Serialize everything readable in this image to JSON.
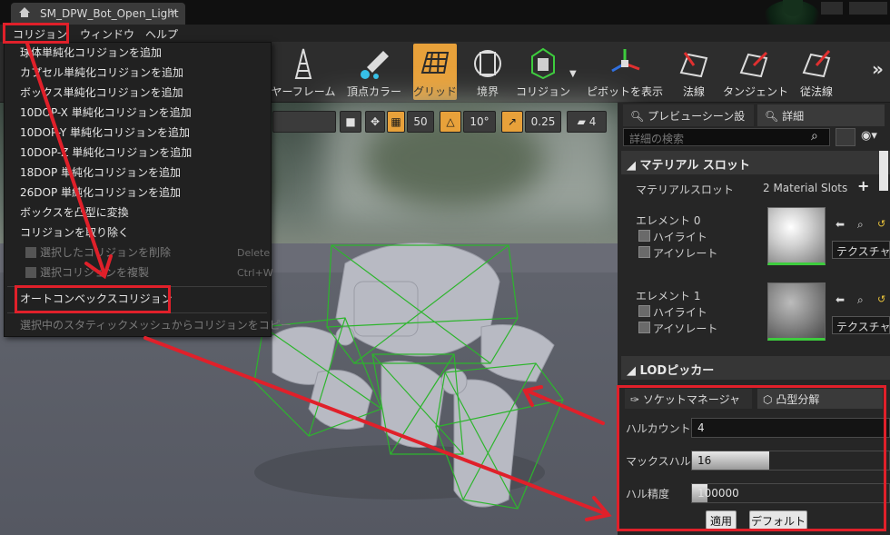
{
  "window": {
    "tab_title": "SM_DPW_Bot_Open_Light",
    "tab_close": "×"
  },
  "menubar": {
    "items": [
      "コリジョン",
      "ウィンドウ",
      "ヘルプ"
    ]
  },
  "toolbar": {
    "buttons": [
      {
        "label": "ヤーフレーム",
        "icon": "wireframe-icon"
      },
      {
        "label": "頂点カラー",
        "icon": "vertex-color-icon"
      },
      {
        "label": "グリッド",
        "icon": "grid-icon",
        "active": true
      },
      {
        "label": "境界",
        "icon": "bounds-icon"
      },
      {
        "label": "コリジョン",
        "icon": "collision-icon"
      },
      {
        "label": "ピボットを表示",
        "icon": "pivot-icon"
      },
      {
        "label": "法線",
        "icon": "normals-icon"
      },
      {
        "label": "タンジェント",
        "icon": "tangents-icon"
      },
      {
        "label": "従法線",
        "icon": "binormals-icon"
      }
    ],
    "overflow": "»"
  },
  "viewport": {
    "grid_snap": "50",
    "rotation_snap": "10°",
    "scale_snap": "0.25",
    "camera_speed": "4"
  },
  "collision_menu": {
    "items": [
      {
        "label": "球体単純化コリジョンを追加",
        "disabled": false
      },
      {
        "label": "カプセル単純化コリジョンを追加",
        "disabled": false
      },
      {
        "label": "ボックス単純化コリジョンを追加",
        "disabled": false
      },
      {
        "label": "10DOP-X 単純化コリジョンを追加",
        "disabled": false
      },
      {
        "label": "10DOP-Y 単純化コリジョンを追加",
        "disabled": false
      },
      {
        "label": "10DOP-Z 単純化コリジョンを追加",
        "disabled": false
      },
      {
        "label": "18DOP 単純化コリジョンを追加",
        "disabled": false
      },
      {
        "label": "26DOP 単純化コリジョンを追加",
        "disabled": false
      },
      {
        "label": "ボックスを凸型に変換",
        "disabled": false
      },
      {
        "label": "コリジョンを取り除く",
        "disabled": false
      },
      {
        "label": "選択したコリジョンを削除",
        "disabled": true,
        "shortcut": "Delete"
      },
      {
        "label": "選択コリジョンを複製",
        "disabled": true,
        "shortcut": "Ctrl+W"
      },
      {
        "label": "オートコンベックスコリジョン",
        "disabled": false
      },
      {
        "label": "選択中のスタティックメッシュからコリジョンをコピー",
        "disabled": true
      }
    ]
  },
  "details": {
    "tabs": [
      "プレビューシーン設",
      "詳細"
    ],
    "search_placeholder": "詳細の検索",
    "material_section": "マテリアル スロット",
    "material_slots_label": "マテリアルスロット",
    "material_slots_value": "2 Material Slots",
    "add_icon": "+",
    "elements": [
      {
        "name": "エレメント 0",
        "highlight": "ハイライト",
        "isolate": "アイソレート",
        "texture": "テクスチャ"
      },
      {
        "name": "エレメント 1",
        "highlight": "ハイライト",
        "isolate": "アイソレート",
        "texture": "テクスチャ"
      }
    ],
    "lod_section": "LODピッカー"
  },
  "decomposition": {
    "tabs": [
      "ソケットマネージャ",
      "凸型分解"
    ],
    "fields": [
      {
        "label": "ハルカウント",
        "value": "4",
        "fill": 0.0
      },
      {
        "label": "マックスハル(",
        "value": "16",
        "fill": 0.39
      },
      {
        "label": "ハル精度",
        "value": "100000",
        "fill": 0.08
      }
    ],
    "apply_label": "適用",
    "default_label": "デフォルト"
  },
  "colors": {
    "annotation_red": "#e0202a",
    "accent_amber": "#e8a13a",
    "collision_green": "#2db52d"
  }
}
